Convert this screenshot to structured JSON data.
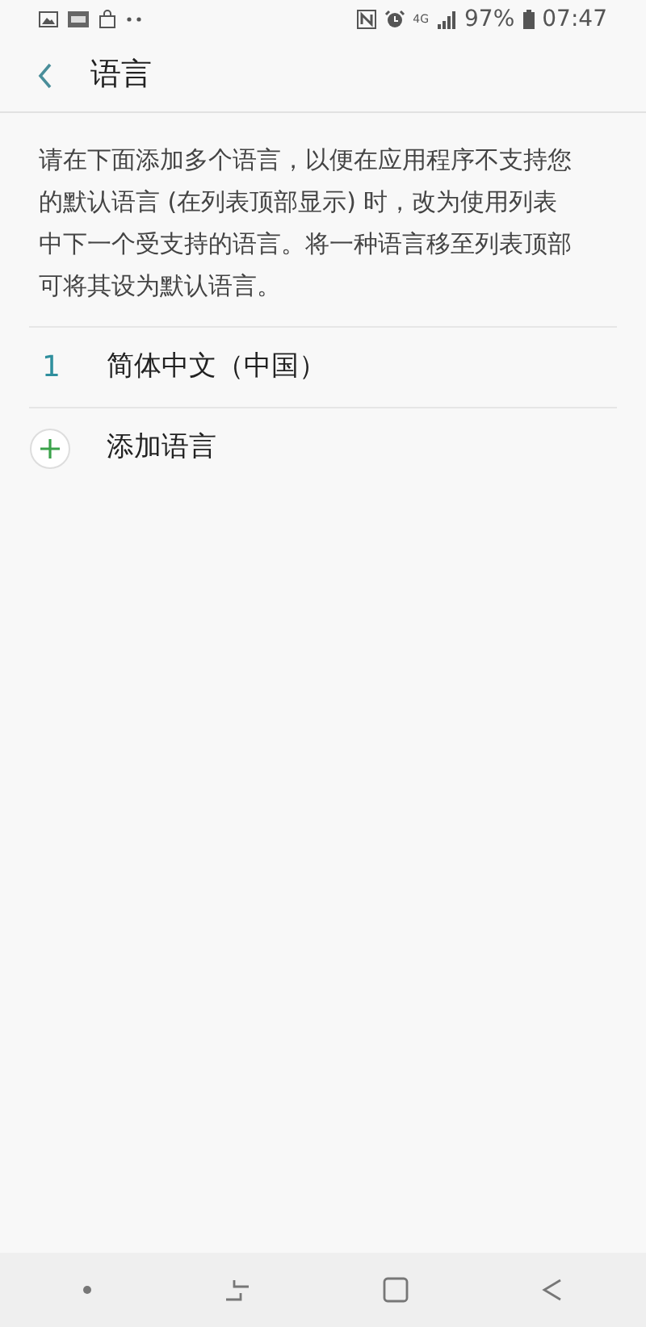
{
  "status_bar": {
    "network": "4G",
    "battery": "97%",
    "time": "07:47"
  },
  "header": {
    "title": "语言"
  },
  "description": "请在下面添加多个语言，以便在应用程序不支持您的默认语言 (在列表顶部显示) 时，改为使用列表中下一个受支持的语言。将一种语言移至列表顶部可将其设为默认语言。",
  "languages": [
    {
      "rank": "1",
      "name": "简体中文（中国）"
    }
  ],
  "add_language": {
    "label": "添加语言"
  }
}
